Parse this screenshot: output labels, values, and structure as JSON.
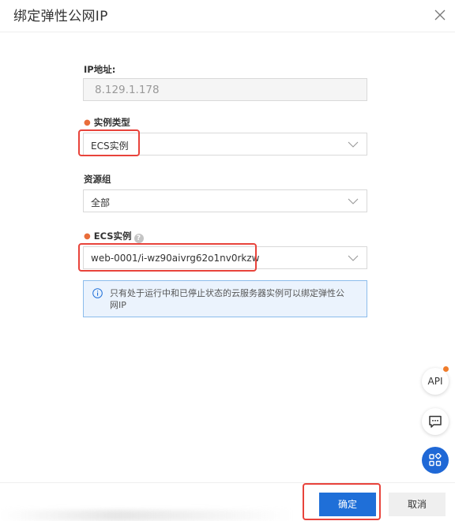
{
  "dialog": {
    "title": "绑定弹性公网IP"
  },
  "form": {
    "ip_label": "IP地址:",
    "ip_value": "8.129.1.178",
    "instance_type_label": "实例类型",
    "instance_type_value": "ECS实例",
    "resource_group_label": "资源组",
    "resource_group_value": "全部",
    "ecs_instance_label": "ECS实例",
    "ecs_instance_help": "?",
    "ecs_instance_value": "web-0001/i-wz90aivrg62o1nv0rkzw"
  },
  "notice": {
    "text": "只有处于运行中和已停止状态的云服务器实例可以绑定弹性公网IP"
  },
  "floating": {
    "api_label": "API"
  },
  "footer": {
    "ok_label": "确定",
    "cancel_label": "取消"
  },
  "colors": {
    "primary": "#1f6fd8",
    "highlight": "#e8433b",
    "required": "#e96d3a",
    "notice_bg": "#ebf3fd"
  }
}
